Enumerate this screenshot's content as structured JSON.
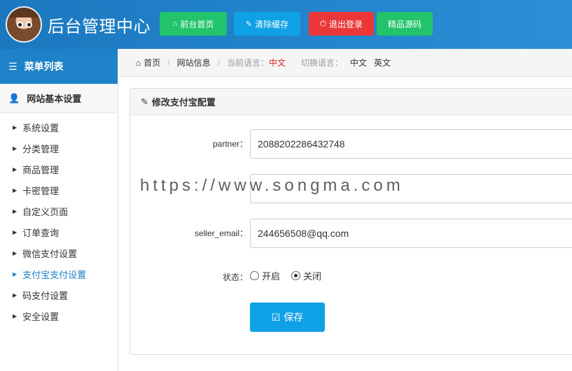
{
  "header": {
    "title": "后台管理中心",
    "buttons": {
      "home": "前台首页",
      "clear_cache": "清除缓存",
      "logout": "退出登录",
      "source": "精品源码"
    }
  },
  "sidebar": {
    "title": "菜单列表",
    "group": "网站基本设置",
    "items": [
      {
        "label": "系统设置"
      },
      {
        "label": "分类管理"
      },
      {
        "label": "商品管理"
      },
      {
        "label": "卡密管理"
      },
      {
        "label": "自定义页面"
      },
      {
        "label": "订单查询"
      },
      {
        "label": "微信支付设置"
      },
      {
        "label": "支付宝支付设置",
        "active": true
      },
      {
        "label": "码支付设置"
      },
      {
        "label": "安全设置"
      }
    ]
  },
  "breadcrumb": {
    "home": "首页",
    "site_info": "网站信息",
    "current_lang_label": "当前语言：",
    "current_lang_value": "中文",
    "switch_lang_label": "切换语言：",
    "lang_options": [
      "中文",
      "英文"
    ]
  },
  "panel": {
    "title": "修改支付宝配置",
    "fields": {
      "partner_label": "partner：",
      "partner_value": "2088202286432748",
      "key_value": "",
      "seller_email_label": "seller_email：",
      "seller_email_value": "244656508@qq.com",
      "status_label": "状态：",
      "status_on": "开启",
      "status_off": "关闭",
      "status_selected": "关闭"
    },
    "save_label": "保存"
  },
  "watermark": "https://www.songma.com",
  "colors": {
    "header_bg": "#1b78bf",
    "menu_title_bg": "#1e82c8",
    "green": "#21c36b",
    "blue": "#0fa1e6",
    "red": "#ea3838",
    "active_link": "#1e82c8",
    "breadcrumb_highlight": "#d9261c"
  }
}
